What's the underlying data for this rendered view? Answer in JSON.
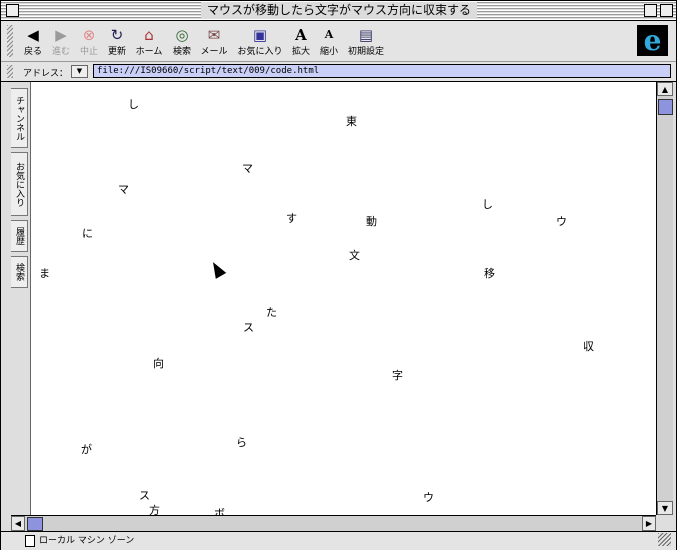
{
  "window": {
    "title": "マウスが移動したら文字がマウス方向に収束する"
  },
  "toolbar": {
    "back": "戻る",
    "forward": "進む",
    "stop": "中止",
    "refresh": "更新",
    "home": "ホーム",
    "search": "検索",
    "mail": "メール",
    "favorites": "お気に入り",
    "larger": "拡大",
    "smaller": "縮小",
    "preferences": "初期設定"
  },
  "address": {
    "label": "アドレス：",
    "url": "file:///IS09660/script/text/009/code.html"
  },
  "sidebar": {
    "tabs": [
      "チャンネル",
      "お気に入り",
      "履歴",
      "検索"
    ]
  },
  "content": {
    "chars": [
      "し",
      "東",
      "マ",
      "マ",
      "す",
      "動",
      "し",
      "ウ",
      "に",
      "文",
      "ま",
      "移",
      "た",
      "ス",
      "収",
      "向",
      "字",
      "ら",
      "が",
      "ス",
      "ウ",
      "方",
      "ボ"
    ]
  },
  "status": {
    "text": "ローカル マシン ゾーン"
  }
}
